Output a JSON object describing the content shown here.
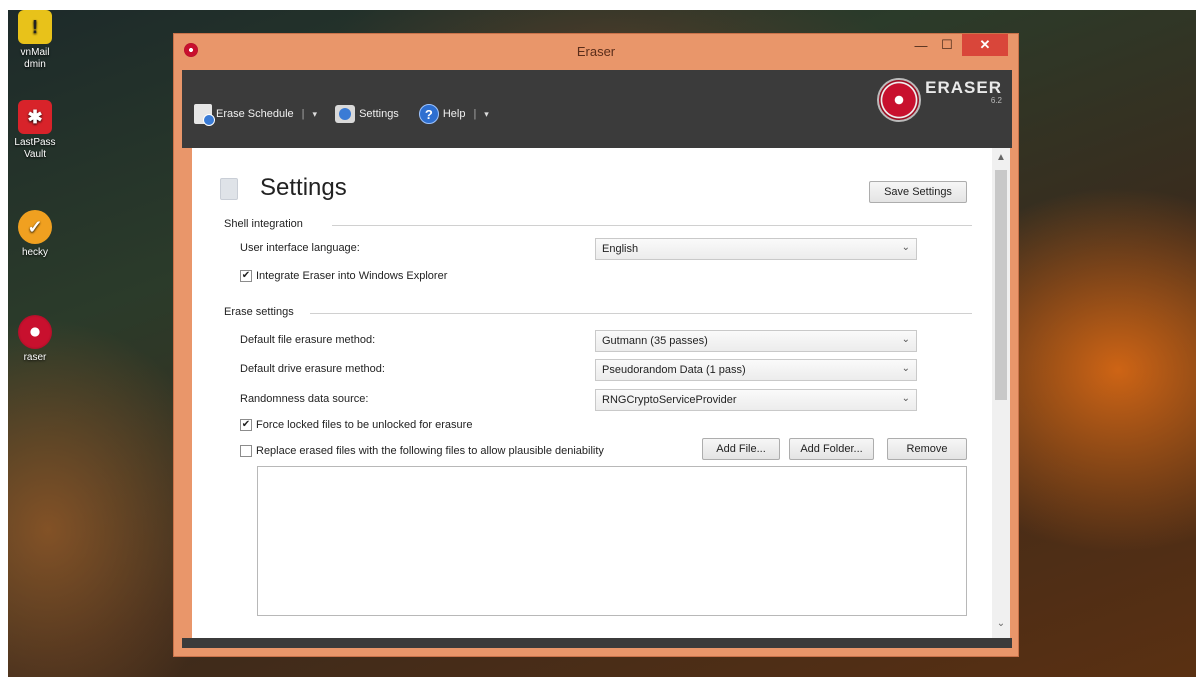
{
  "desktop": {
    "icons": [
      {
        "label": "vnMail\ndmin",
        "icon": "warning-icon",
        "color": "#e8c21a"
      },
      {
        "label": "LastPass\nVault",
        "icon": "lastpass-icon",
        "color": "#d8232a"
      },
      {
        "label": "hecky",
        "icon": "checky-icon",
        "color": "#f0a020"
      },
      {
        "label": "raser",
        "icon": "eraser-icon",
        "color": "#c8102e"
      }
    ]
  },
  "window": {
    "title": "Eraser",
    "min_glyph": "—",
    "max_glyph": "☐",
    "close_glyph": "✕"
  },
  "toolbar": {
    "erase_schedule": "Erase Schedule",
    "settings": "Settings",
    "help": "Help",
    "separator": "|",
    "drop": "▾"
  },
  "brand": {
    "name": "ERASER",
    "version": "6.2"
  },
  "page": {
    "title": "Settings",
    "save_button": "Save Settings"
  },
  "shell": {
    "group": "Shell integration",
    "language_label": "User interface language:",
    "language_value": "English",
    "integrate_label": "Integrate Eraser into Windows Explorer",
    "integrate_checked": true
  },
  "erase": {
    "group": "Erase settings",
    "file_method_label": "Default file erasure method:",
    "file_method_value": "Gutmann (35 passes)",
    "drive_method_label": "Default drive erasure method:",
    "drive_method_value": "Pseudorandom Data (1 pass)",
    "random_label": "Randomness data source:",
    "random_value": "RNGCryptoServiceProvider",
    "force_label": "Force locked files to be unlocked for erasure",
    "force_checked": true,
    "replace_label": "Replace erased files with the following files to allow plausible deniability",
    "replace_checked": false,
    "add_file": "Add File...",
    "add_folder": "Add Folder...",
    "remove": "Remove"
  },
  "glyphs": {
    "check": "✔",
    "chevron": "⌄",
    "up": "▲",
    "down": "⌄",
    "help_q": "?"
  }
}
